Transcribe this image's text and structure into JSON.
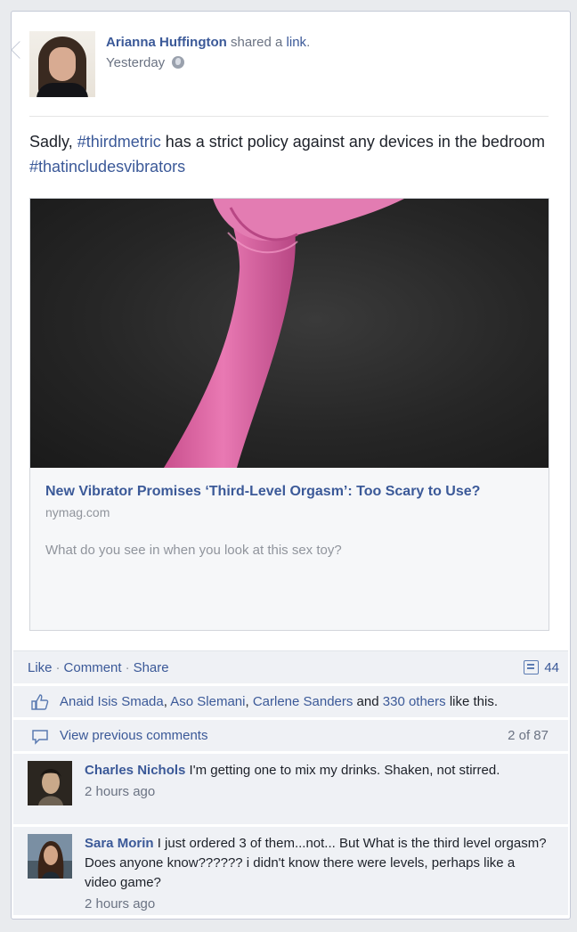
{
  "post": {
    "author": "Arianna Huffington",
    "shared_prefix": "shared a",
    "shared_link": "link",
    "shared_suffix": ".",
    "timestamp": "Yesterday",
    "privacy_icon": "globe-icon",
    "status_pre": "Sadly, ",
    "hashtag1": "#thirdmetric",
    "status_mid": " has a strict policy against any devices in the bedroom ",
    "hashtag2": "#thatincludesvibrators"
  },
  "link_preview": {
    "title": "New Vibrator Promises ‘Third-Level Orgasm’: Too Scary to Use?",
    "domain": "nymag.com",
    "description": "What do you see in when you look at this sex toy?"
  },
  "actions": {
    "like": "Like",
    "comment": "Comment",
    "share": "Share",
    "separator": "·",
    "comment_count": "44"
  },
  "likes": {
    "names": [
      "Anaid Isis Smada",
      "Aso Slemani",
      "Carlene Sanders"
    ],
    "sep": ", ",
    "and": " and ",
    "others": "330 others",
    "suffix": " like this."
  },
  "view_previous": {
    "label": "View previous comments",
    "count": "2 of 87"
  },
  "comments": [
    {
      "author": "Charles Nichols",
      "text": "I'm getting one to mix my drinks. Shaken, not stirred.",
      "time": "2 hours ago"
    },
    {
      "author": "Sara Morin",
      "text": "I just ordered 3 of them...not... But What is the third level orgasm? Does anyone know?????? i didn't know there were levels, perhaps like a video game?",
      "time": "2 hours ago"
    }
  ],
  "colors": {
    "link": "#3b5998",
    "muted": "#6b7383",
    "panel": "#eff1f5",
    "toy_pink": "#e06aa6"
  }
}
